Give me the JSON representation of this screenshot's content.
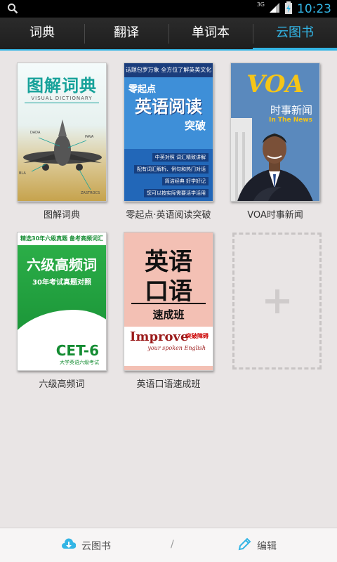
{
  "status_bar": {
    "time": "10:23",
    "network": "3G",
    "icons": [
      "search-icon",
      "signal-icon",
      "battery-icon"
    ],
    "accent": "#33b5e5"
  },
  "tabs": [
    {
      "label": "词典",
      "active": false
    },
    {
      "label": "翻译",
      "active": false
    },
    {
      "label": "单词本",
      "active": false
    },
    {
      "label": "云图书",
      "active": true
    }
  ],
  "books": [
    {
      "title": "图解词典",
      "cover": {
        "title": "图解词典",
        "subtitle": "VISUAL DICTIONARY",
        "labels": [
          "DADA",
          "PAVA",
          "BLA",
          "ZASTROCS"
        ]
      }
    },
    {
      "title": "零起点·英语阅读突破",
      "cover": {
        "top": "话题包罗万象  全方位了解英美文化",
        "prefix": "零起点",
        "main": "英语阅读",
        "sub": "突破",
        "bullets": [
          "中英对照  词汇精致讲解",
          "配有词汇解析、例句和热门对话",
          "简洁经典  好学好记",
          "您可以按实际需要活学活用"
        ]
      }
    },
    {
      "title": "VOA时事新闻",
      "cover": {
        "logo": "VOA",
        "news": "时事新闻",
        "tagline": "In The News"
      }
    },
    {
      "title": "六级高频词",
      "cover": {
        "band": "精选30年六级真题 备考高频词汇",
        "main": "六级高频词",
        "sub": "30年考试真题对照",
        "exam": "CET-6",
        "exam_sub": "大学英语六级考试"
      }
    },
    {
      "title": "英语口语速成班",
      "cover": {
        "line1": "英语",
        "line2": "口语",
        "line3": "速成班",
        "improve": "Improve",
        "improve_cn": "突破障碍",
        "improve_sub": "your spoken English"
      }
    }
  ],
  "add_slot": {
    "icon": "plus-icon"
  },
  "bottom_bar": {
    "left_label": "云图书",
    "left_icon": "cloud-download-icon",
    "separator": "/",
    "right_label": "编辑",
    "right_icon": "pencil-icon"
  }
}
